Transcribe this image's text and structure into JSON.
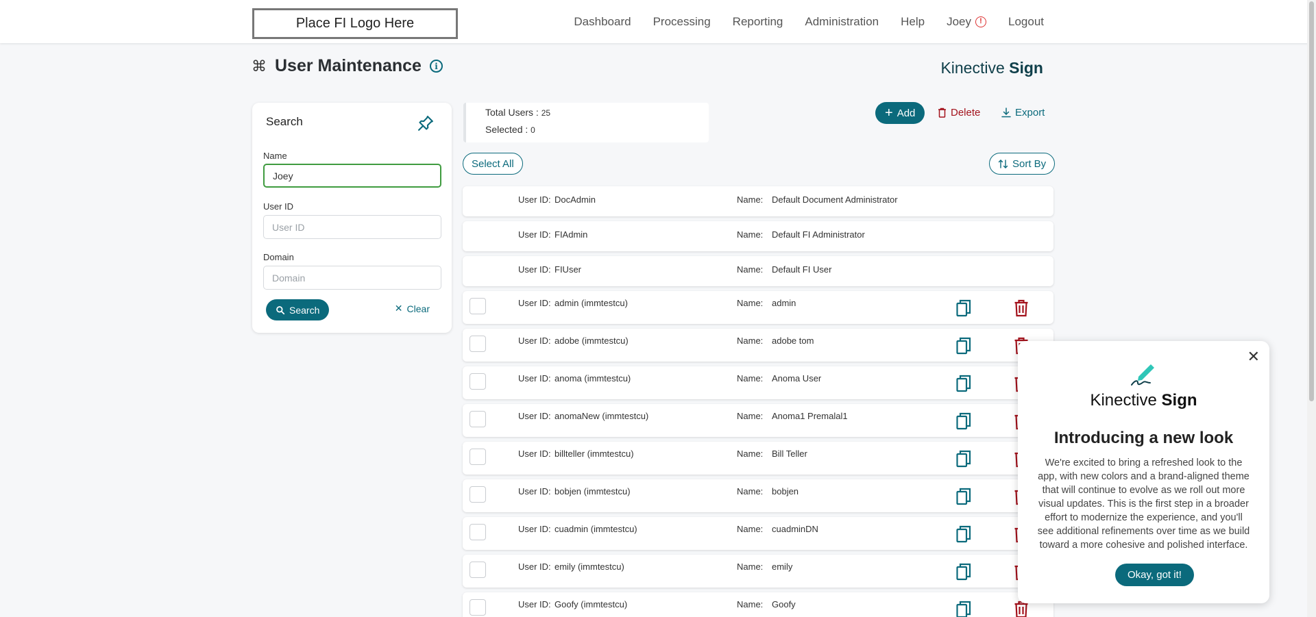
{
  "header": {
    "logo_text": "Place FI Logo Here",
    "nav": [
      "Dashboard",
      "Processing",
      "Reporting",
      "Administration",
      "Help"
    ],
    "user_name": "Joey",
    "logout": "Logout"
  },
  "page": {
    "title": "User Maintenance",
    "brand_light": "Kinective ",
    "brand_bold": "Sign"
  },
  "search": {
    "title": "Search",
    "name_label": "Name",
    "name_value": "Joey",
    "userid_label": "User ID",
    "userid_placeholder": "User ID",
    "domain_label": "Domain",
    "domain_placeholder": "Domain",
    "search_button": "Search",
    "clear_button": "Clear"
  },
  "summary": {
    "total_label": "Total Users : ",
    "total_value": "25",
    "selected_label": "Selected : ",
    "selected_value": "0"
  },
  "actions": {
    "add": "Add",
    "delete": "Delete",
    "export": "Export",
    "select_all": "Select All",
    "sort_by": "Sort By"
  },
  "list": {
    "uid_label": "User ID:",
    "name_label": "Name:",
    "system_users": [
      {
        "user_id": "DocAdmin",
        "name": "Default Document Administrator"
      },
      {
        "user_id": "FIAdmin",
        "name": "Default FI Administrator"
      },
      {
        "user_id": "FIUser",
        "name": "Default FI User"
      }
    ],
    "users": [
      {
        "user_id": "admin (immtestcu)",
        "name": "admin"
      },
      {
        "user_id": "adobe (immtestcu)",
        "name": "adobe tom"
      },
      {
        "user_id": "anoma (immtestcu)",
        "name": "Anoma User"
      },
      {
        "user_id": "anomaNew (immtestcu)",
        "name": "Anoma1 Premalal1"
      },
      {
        "user_id": "billteller (immtestcu)",
        "name": "Bill Teller"
      },
      {
        "user_id": "bobjen (immtestcu)",
        "name": "bobjen"
      },
      {
        "user_id": "cuadmin (immtestcu)",
        "name": "cuadminDN"
      },
      {
        "user_id": "emily (immtestcu)",
        "name": "emily"
      },
      {
        "user_id": "Goofy (immtestcu)",
        "name": "Goofy"
      }
    ]
  },
  "popup": {
    "brand_light": "Kinective ",
    "brand_bold": "Sign",
    "title": "Introducing a new look",
    "body": "We're excited to bring a refreshed look to the app, with new colors and a brand-aligned theme that will continue to evolve as we roll out more visual updates. This is the first step in a broader effort to modernize the experience, and you'll see additional refinements over time as we build toward a more cohesive and polished interface.",
    "ok_button": "Okay, got it!"
  },
  "colors": {
    "primary": "#0b6a7c",
    "danger": "#a3121c",
    "focus": "#3f9b3f"
  }
}
